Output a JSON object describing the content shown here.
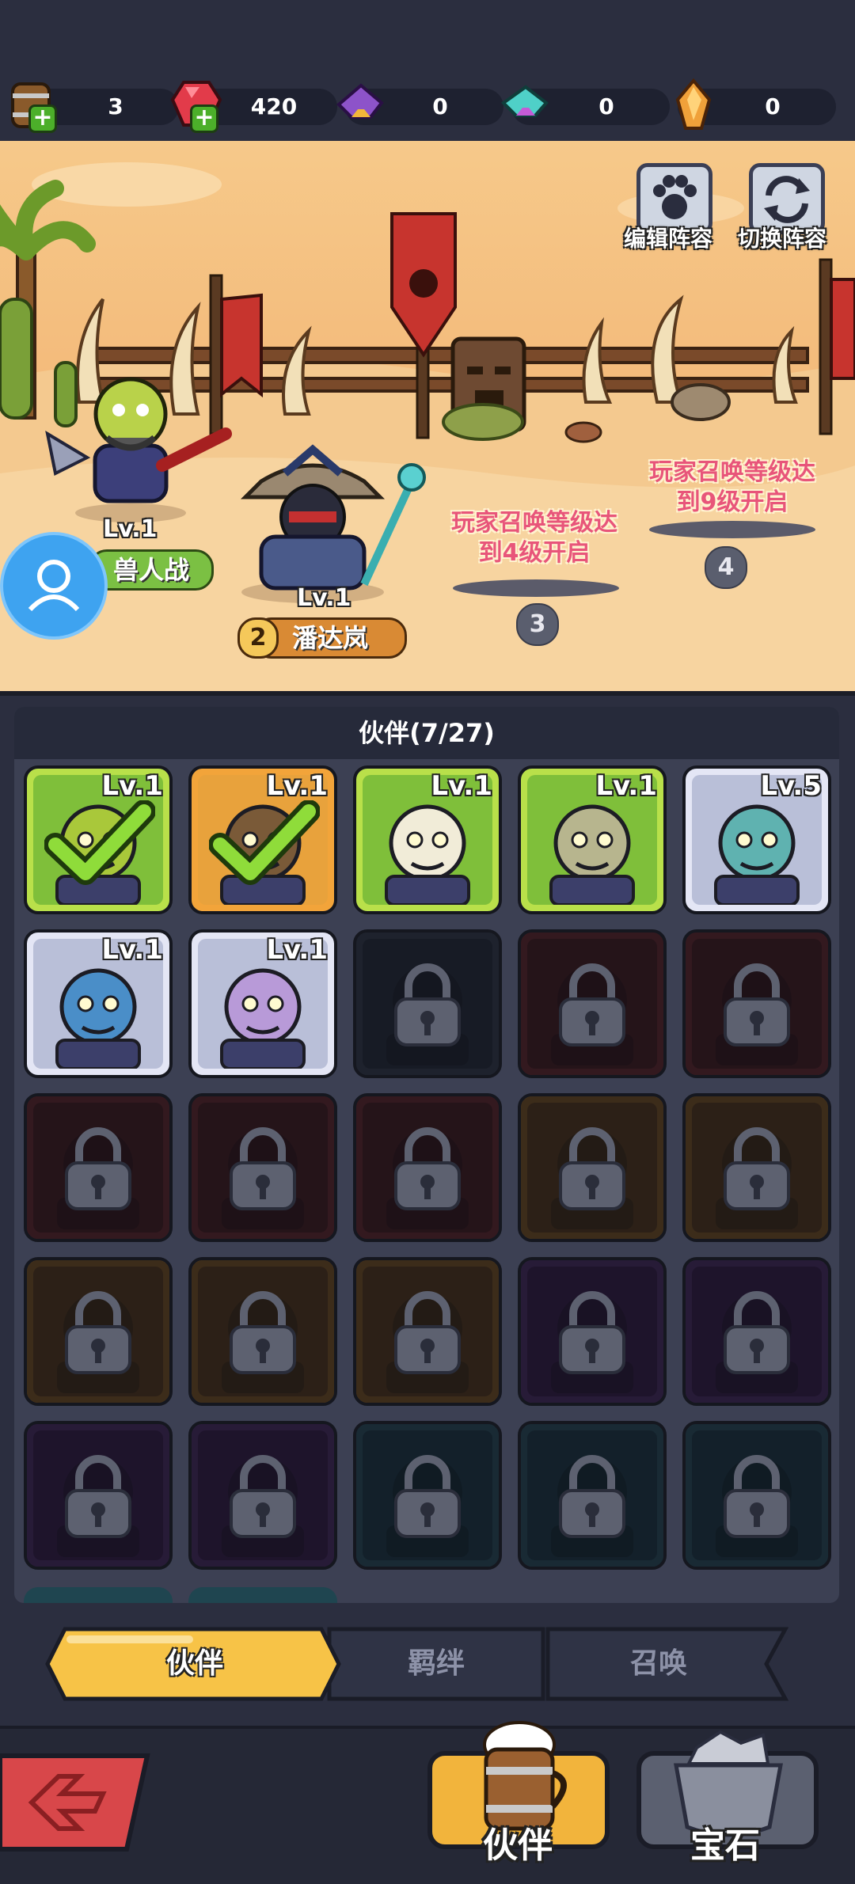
{
  "resources": [
    {
      "name": "beer-keg",
      "value": "3",
      "has_plus": true
    },
    {
      "name": "ruby",
      "value": "420",
      "has_plus": true
    },
    {
      "name": "purple-crystal",
      "value": "0",
      "has_plus": false
    },
    {
      "name": "teal-crystal",
      "value": "0",
      "has_plus": false
    },
    {
      "name": "amber-crystal",
      "value": "0",
      "has_plus": false
    }
  ],
  "scene": {
    "edit_lineup": "编辑阵容",
    "switch_lineup": "切换阵容",
    "slot3_lock": "玩家召唤等级达\n到4级开启",
    "slot4_lock": "玩家召唤等级达\n到9级开启",
    "slot3_num": "3",
    "slot4_num": "4",
    "hero1": {
      "level": "Lv.1",
      "name": "兽人战"
    },
    "hero2": {
      "level": "Lv.1",
      "name": "潘达岚",
      "slot": "2"
    }
  },
  "panel": {
    "title": "伙伴(7/27)",
    "cards": [
      {
        "lv": "Lv.1",
        "frame": "green",
        "selected": true,
        "locked": false,
        "face": "orc"
      },
      {
        "lv": "Lv.1",
        "frame": "orange",
        "selected": true,
        "locked": false,
        "face": "panda"
      },
      {
        "lv": "Lv.1",
        "frame": "green",
        "selected": false,
        "locked": false,
        "face": "elf-white"
      },
      {
        "lv": "Lv.1",
        "frame": "green",
        "selected": false,
        "locked": false,
        "face": "undead"
      },
      {
        "lv": "Lv.5",
        "frame": "white",
        "selected": false,
        "locked": false,
        "face": "teal-beast"
      },
      {
        "lv": "Lv.1",
        "frame": "white",
        "selected": false,
        "locked": false,
        "face": "troll"
      },
      {
        "lv": "Lv.1",
        "frame": "white",
        "selected": false,
        "locked": false,
        "face": "elf-purple"
      },
      {
        "lv": "",
        "frame": "dark",
        "selected": false,
        "locked": true,
        "face": ""
      },
      {
        "lv": "",
        "frame": "red",
        "selected": false,
        "locked": true,
        "face": ""
      },
      {
        "lv": "",
        "frame": "red",
        "selected": false,
        "locked": true,
        "face": ""
      },
      {
        "lv": "",
        "frame": "red",
        "selected": false,
        "locked": true,
        "face": ""
      },
      {
        "lv": "",
        "frame": "red",
        "selected": false,
        "locked": true,
        "face": ""
      },
      {
        "lv": "",
        "frame": "red",
        "selected": false,
        "locked": true,
        "face": ""
      },
      {
        "lv": "",
        "frame": "gold",
        "selected": false,
        "locked": true,
        "face": ""
      },
      {
        "lv": "",
        "frame": "gold",
        "selected": false,
        "locked": true,
        "face": ""
      },
      {
        "lv": "",
        "frame": "gold",
        "selected": false,
        "locked": true,
        "face": ""
      },
      {
        "lv": "",
        "frame": "gold",
        "selected": false,
        "locked": true,
        "face": ""
      },
      {
        "lv": "",
        "frame": "gold",
        "selected": false,
        "locked": true,
        "face": ""
      },
      {
        "lv": "",
        "frame": "purple",
        "selected": false,
        "locked": true,
        "face": ""
      },
      {
        "lv": "",
        "frame": "purple",
        "selected": false,
        "locked": true,
        "face": ""
      },
      {
        "lv": "",
        "frame": "purple",
        "selected": false,
        "locked": true,
        "face": ""
      },
      {
        "lv": "",
        "frame": "purple",
        "selected": false,
        "locked": true,
        "face": ""
      },
      {
        "lv": "",
        "frame": "teal",
        "selected": false,
        "locked": true,
        "face": ""
      },
      {
        "lv": "",
        "frame": "teal",
        "selected": false,
        "locked": true,
        "face": ""
      },
      {
        "lv": "",
        "frame": "teal",
        "selected": false,
        "locked": true,
        "face": ""
      }
    ]
  },
  "tabs": {
    "partner": "伙伴",
    "bond": "羁绊",
    "summon": "召唤"
  },
  "bottom": {
    "partner_label": "伙伴",
    "gem_label": "宝石"
  },
  "colors": {
    "frame_green": "#b9e04a",
    "frame_orange": "#f2a43a",
    "frame_white": "#e4e6f5",
    "frame_dark": "#2a3340",
    "frame_red": "#5a1f22",
    "frame_gold": "#6e4a18",
    "frame_purple": "#3f2458",
    "frame_teal": "#1f4550",
    "active_tab": "#f7c347"
  }
}
